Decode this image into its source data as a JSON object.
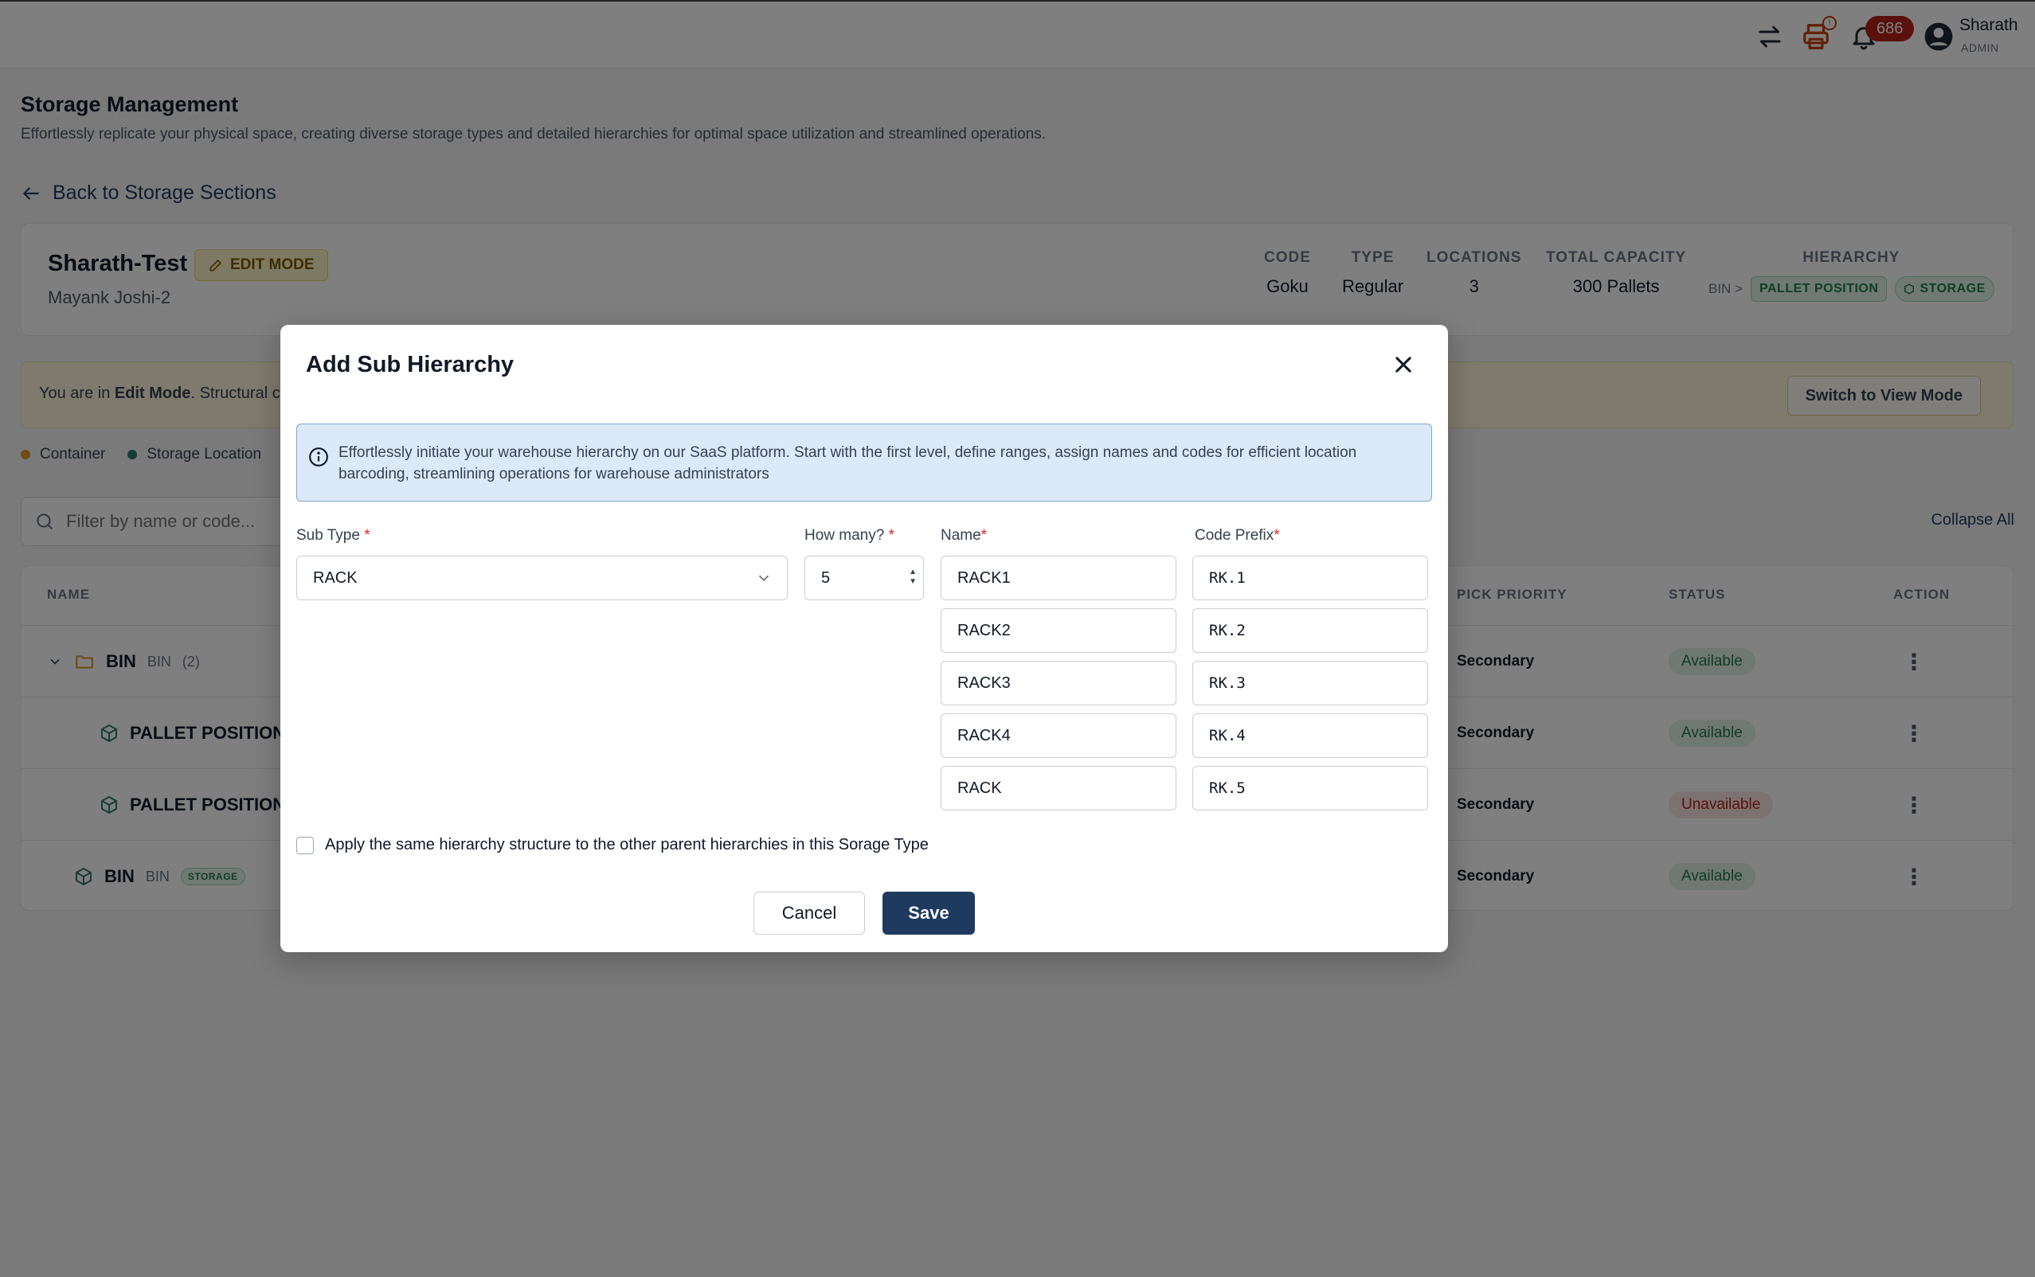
{
  "topbar": {
    "swap_icon": "swap-arrows-icon",
    "print_icon": "printer-icon",
    "print_badge": "!",
    "bell_icon": "bell-icon",
    "notification_count": "686",
    "user_icon": "user-circle-icon",
    "user_name": "Sharath",
    "user_role": "ADMIN"
  },
  "page": {
    "title": "Storage Management",
    "subtitle": "Effortlessly replicate your physical space, creating diverse storage types and detailed hierarchies for optimal space utilization and streamlined operations.",
    "back_link": "Back to Storage Sections"
  },
  "section": {
    "name": "Sharath-Test",
    "mode_badge": "EDIT MODE",
    "owner": "Mayank Joshi-2",
    "meta": {
      "code_label": "CODE",
      "code_value": "Goku",
      "type_label": "TYPE",
      "type_value": "Regular",
      "locations_label": "LOCATIONS",
      "locations_value": "3",
      "capacity_label": "TOTAL CAPACITY",
      "capacity_value": "300 Pallets",
      "hierarchy_label": "HIERARCHY",
      "hierarchy_bin": "BIN >",
      "hierarchy_pallet": "PALLET POSITION",
      "hierarchy_storage": "STORAGE"
    }
  },
  "banner": {
    "prefix": "You are in ",
    "mode": "Edit Mode",
    "suffix": ". Structural ch",
    "switch_button": "Switch to View Mode"
  },
  "legend": [
    {
      "label": "Container",
      "color": "#d99a2b"
    },
    {
      "label": "Storage Location",
      "color": "#2f7a6a"
    }
  ],
  "search": {
    "placeholder": "Filter by name or code..."
  },
  "collapse_all": "Collapse All",
  "table": {
    "headers": {
      "name": "NAME",
      "pick_priority": "PICK PRIORITY",
      "status": "STATUS",
      "action": "ACTION"
    },
    "rows": [
      {
        "name": "BIN",
        "sub": "BIN",
        "count": "(2)",
        "priority": "Secondary",
        "status": "Available"
      },
      {
        "name": "PALLET POSITION",
        "priority": "Secondary",
        "status": "Available"
      },
      {
        "name": "PALLET POSITION",
        "priority": "Secondary",
        "status": "Unavailable"
      },
      {
        "name": "BIN",
        "sub": "BIN",
        "tag": "STORAGE",
        "priority": "Secondary",
        "status": "Available"
      }
    ]
  },
  "modal": {
    "title": "Add Sub Hierarchy",
    "info": "Effortlessly initiate your warehouse hierarchy on our SaaS platform. Start with the first level, define ranges, assign names and codes for efficient location barcoding, streamlining operations for warehouse administrators",
    "sub_type_label": "Sub Type",
    "sub_type_value": "RACK",
    "how_many_label": "How many?",
    "how_many_value": "5",
    "name_label": "Name",
    "code_prefix_label": "Code Prefix",
    "required_mark": "*",
    "names": [
      "RACK1",
      "RACK2",
      "RACK3",
      "RACK4",
      "RACK"
    ],
    "codes": [
      "RK.1",
      "RK.2",
      "RK.3",
      "RK.4",
      "RK.5"
    ],
    "apply_same_label": "Apply the same hierarchy structure to the other parent hierarchies in this Sorage Type",
    "cancel_button": "Cancel",
    "save_button": "Save"
  }
}
